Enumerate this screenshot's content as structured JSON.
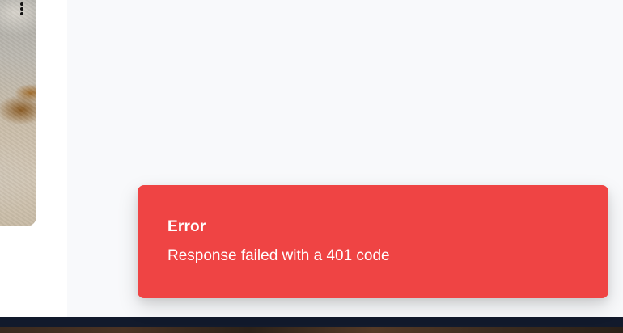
{
  "toast": {
    "title": "Error",
    "message": "Response failed with a 401 code",
    "color": "#ef4444"
  },
  "media_card": {
    "menu_icon": "more-vertical-icon"
  },
  "theme": {
    "main_background": "#f8f9fb",
    "bottom_strip": "#121a2c"
  }
}
